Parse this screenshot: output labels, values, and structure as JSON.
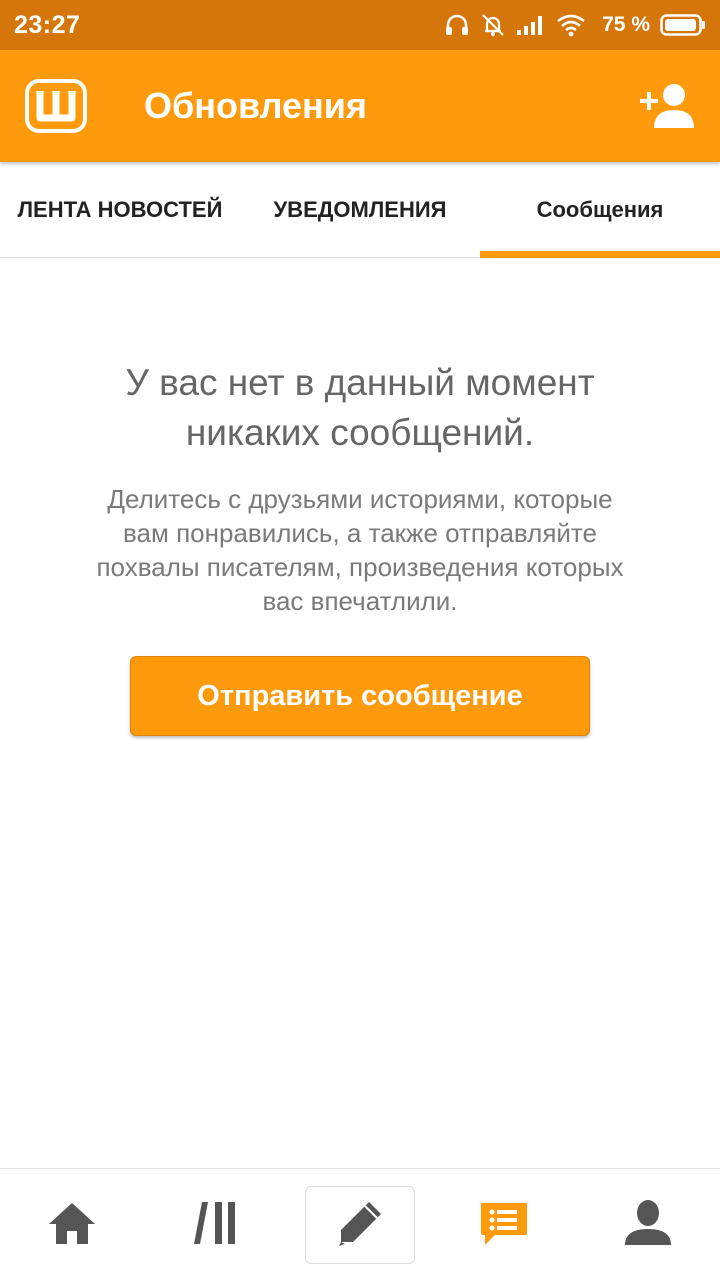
{
  "status_bar": {
    "time": "23:27",
    "battery": "75 %",
    "icons": [
      "headphones-icon",
      "alarm-off-icon",
      "signal-icon",
      "wifi-icon",
      "battery-icon"
    ]
  },
  "app_bar": {
    "title": "Обновления",
    "logo_icon": "wattpad-logo-icon",
    "action_icon": "add-friend-icon"
  },
  "tabs": [
    {
      "label": "ЛЕНТА НОВОСТЕЙ",
      "active": false
    },
    {
      "label": "УВЕДОМЛЕНИЯ",
      "active": false
    },
    {
      "label": "Сообщения",
      "active": true
    }
  ],
  "empty_state": {
    "title_line1": "У вас нет в данный момент",
    "title_line2": "никаких сообщений.",
    "body_line1": "Делитесь с друзьями историями, которые",
    "body_line2": "вам понравились, а также отправляйте",
    "body_line3": "похвалы писателям, произведения которых",
    "body_line4": "вас впечатлили.",
    "button_label": "Отправить сообщение"
  },
  "bottom_nav": {
    "items": [
      "home-icon",
      "library-icon",
      "write-icon",
      "messages-icon",
      "profile-icon"
    ],
    "active": "messages-icon"
  },
  "colors": {
    "accent": "#FF9A0C",
    "status_bar": "#D4760A",
    "icon_gray": "#555555"
  }
}
